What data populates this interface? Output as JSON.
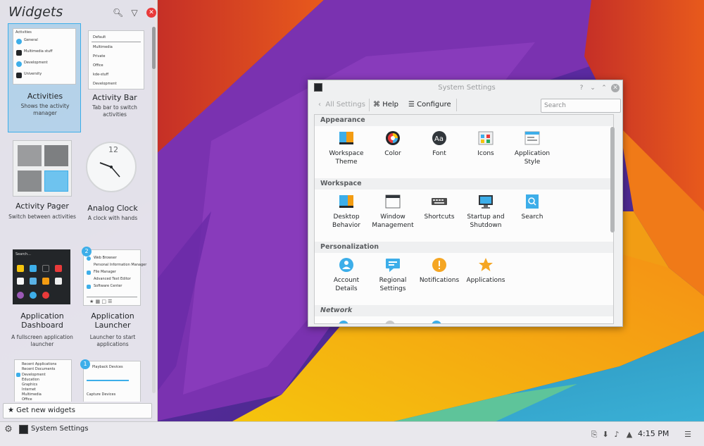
{
  "sidebar": {
    "title": "Widgets",
    "icons": [
      "search-icon",
      "filter-icon",
      "close-icon"
    ],
    "widgets": [
      {
        "name": "Activities",
        "desc": "Shows the activity manager",
        "selected": true,
        "thumb_rows": [
          "General",
          "Multimedia stuff",
          "Development",
          "University"
        ]
      },
      {
        "name": "Activity Bar",
        "desc": "Tab bar to switch activities",
        "thumb_rows": [
          "Default",
          "Multimedia",
          "Private",
          "Office",
          "kde-stuff",
          "Development"
        ]
      },
      {
        "name": "Activity Pager",
        "desc": "Switch between activities"
      },
      {
        "name": "Analog Clock",
        "desc": "A clock with hands",
        "clock_label": "12"
      },
      {
        "name": "Application Dashboard",
        "desc": "A fullscreen application launcher",
        "thumb_search": "Search..."
      },
      {
        "name": "Application Launcher",
        "desc": "Launcher to start applications",
        "badge": "2",
        "thumb_rows": [
          "Web Browser",
          "Personal Information Manager",
          "File Manager",
          "Advanced Text Editor",
          "Software Center"
        ]
      },
      {
        "name": "",
        "desc": "",
        "thumb_rows": [
          "Recent Applications",
          "Recent Documents",
          "Development",
          "Education",
          "Graphics",
          "Internet",
          "Multimedia",
          "Office"
        ]
      },
      {
        "name": "",
        "desc": "",
        "badge": "1",
        "thumb_rows": [
          "Playback Devices",
          "Capture Devices"
        ]
      }
    ],
    "get_new": "Get new widgets"
  },
  "taskbar": {
    "task_label": "System Settings",
    "clock": "4:15 PM"
  },
  "window": {
    "title": "System Settings",
    "toolbar": {
      "all_settings": "All Settings",
      "help": "Help",
      "configure": "Configure",
      "search_placeholder": "Search"
    },
    "sections": [
      {
        "title": "Appearance",
        "items": [
          {
            "label": "Workspace Theme",
            "icon": "workspace-theme-icon"
          },
          {
            "label": "Color",
            "icon": "color-icon"
          },
          {
            "label": "Font",
            "icon": "font-icon"
          },
          {
            "label": "Icons",
            "icon": "icons-icon"
          },
          {
            "label": "Application Style",
            "icon": "application-style-icon"
          }
        ]
      },
      {
        "title": "Workspace",
        "items": [
          {
            "label": "Desktop Behavior",
            "icon": "desktop-behavior-icon"
          },
          {
            "label": "Window Management",
            "icon": "window-management-icon"
          },
          {
            "label": "Shortcuts",
            "icon": "keyboard-icon"
          },
          {
            "label": "Startup and Shutdown",
            "icon": "monitor-icon"
          },
          {
            "label": "Search",
            "icon": "search-icon"
          }
        ]
      },
      {
        "title": "Personalization",
        "items": [
          {
            "label": "Account Details",
            "icon": "account-icon"
          },
          {
            "label": "Regional Settings",
            "icon": "chat-flag-icon"
          },
          {
            "label": "Notifications",
            "icon": "notification-icon"
          },
          {
            "label": "Applications",
            "icon": "star-icon"
          }
        ]
      },
      {
        "title": "Network",
        "items": []
      }
    ]
  },
  "colors": {
    "accent": "#3daee9",
    "window_bg": "#eff0f1",
    "text": "#232629"
  }
}
